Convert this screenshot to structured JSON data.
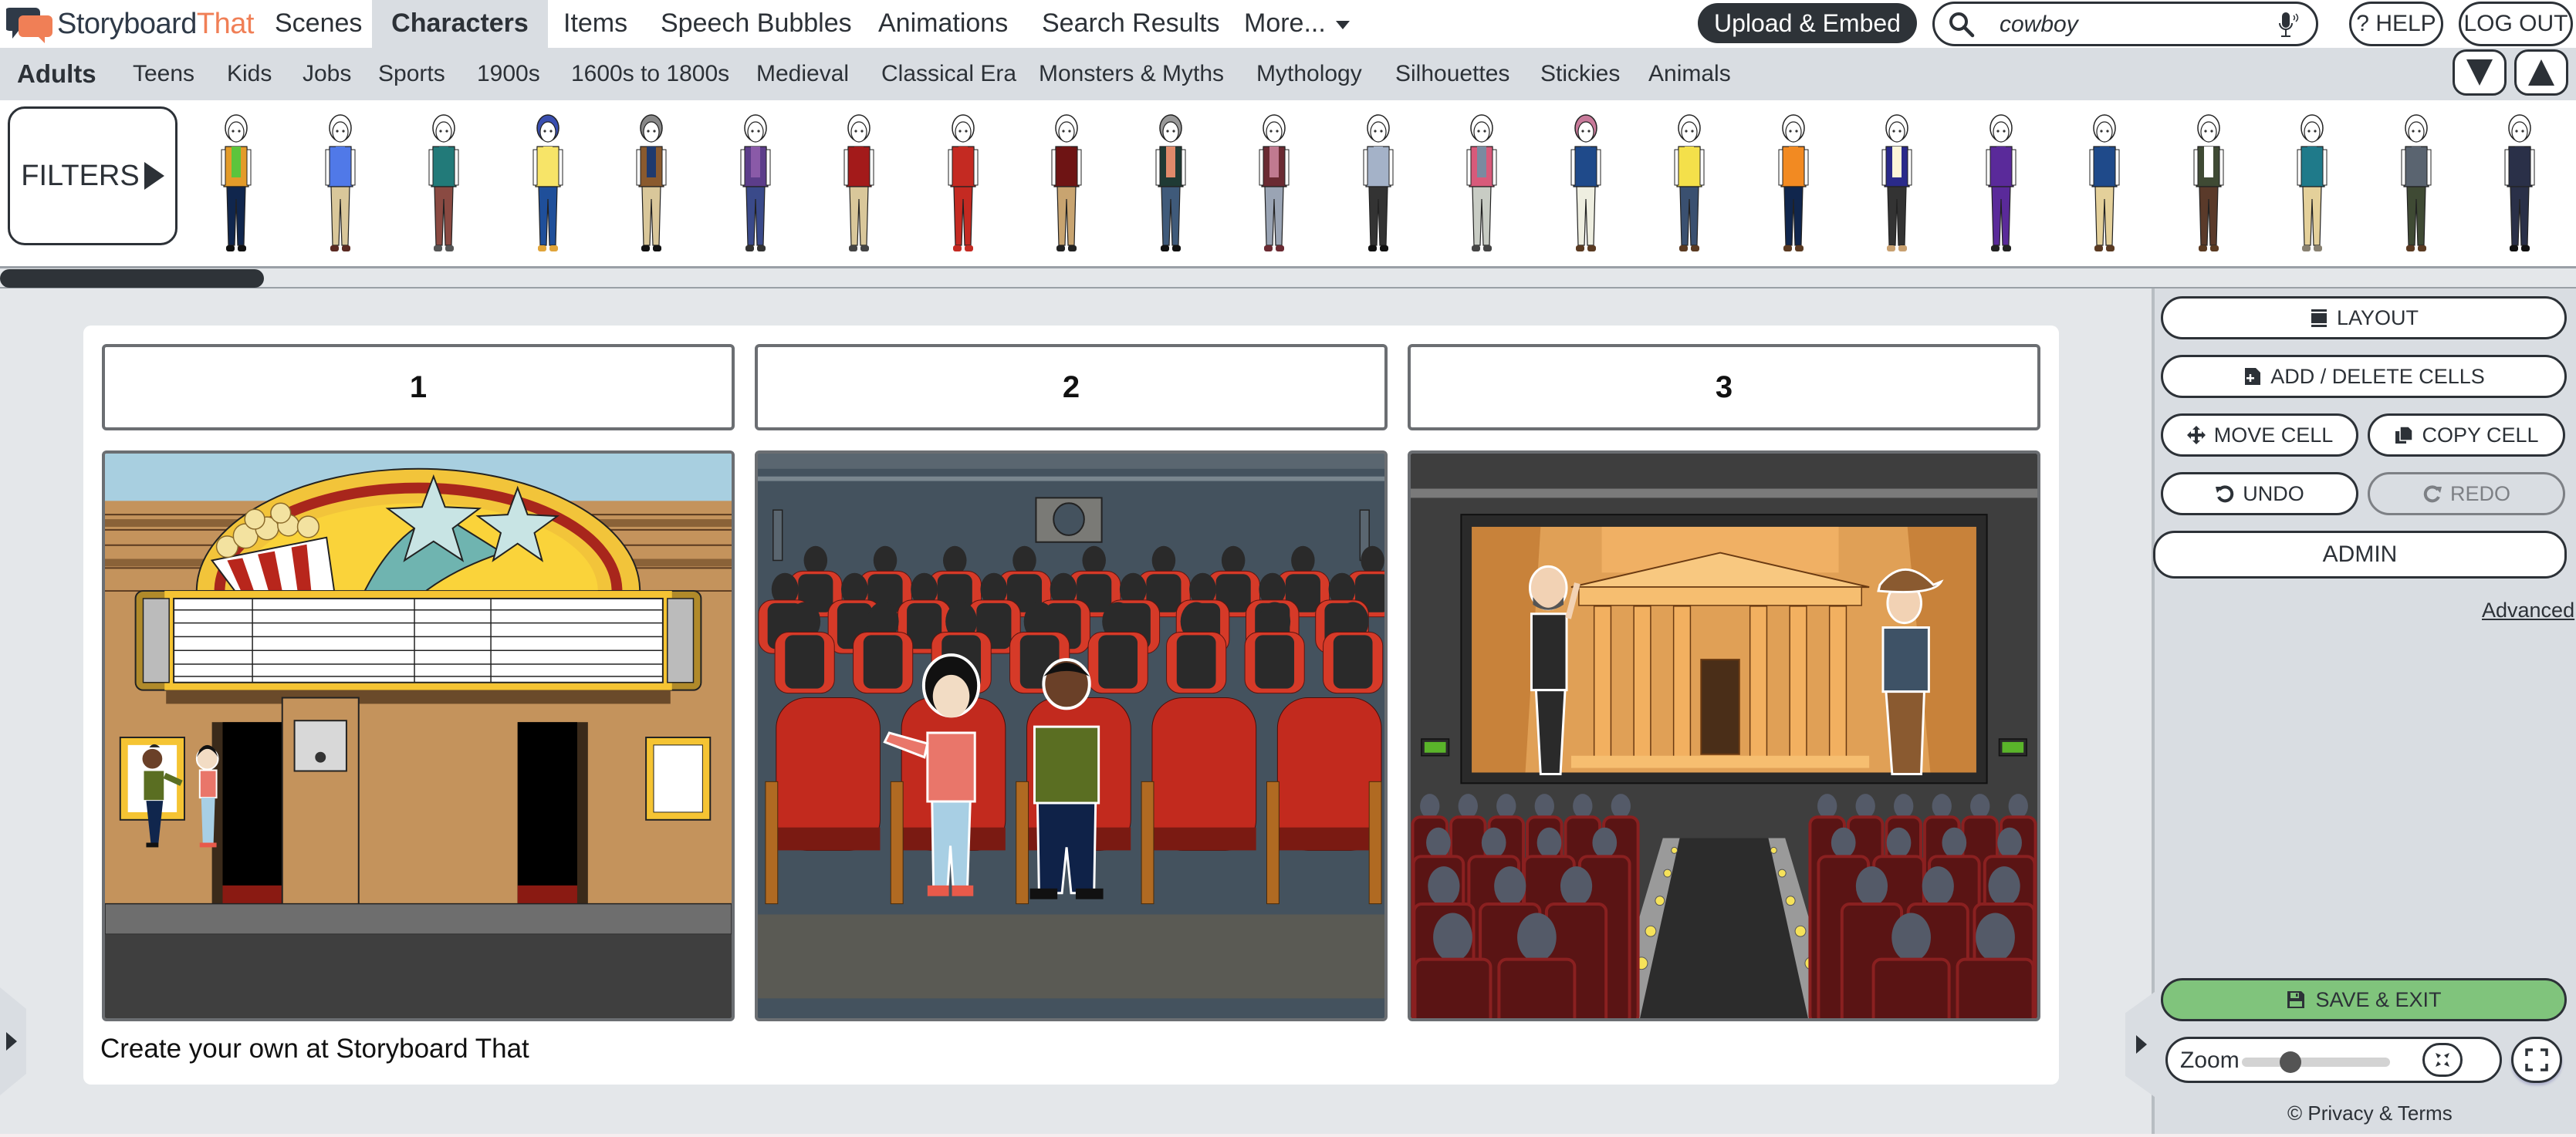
{
  "brand": {
    "name_part1": "Storyboard",
    "name_part2": "That",
    "colors": {
      "dark": "#2f3a48",
      "accent": "#f07f56"
    }
  },
  "top_nav": {
    "tabs": [
      {
        "label": "Scenes",
        "active": false
      },
      {
        "label": "Characters",
        "active": true
      },
      {
        "label": "Items",
        "active": false
      },
      {
        "label": "Speech Bubbles",
        "active": false
      },
      {
        "label": "Animations",
        "active": false
      },
      {
        "label": "Search Results",
        "active": false
      },
      {
        "label": "More...",
        "active": false,
        "icon": "caret-down-icon"
      }
    ],
    "upload_label": "Upload & Embed",
    "search": {
      "value": "cowboy",
      "icon": "search-icon",
      "mic_icon": "microphone-icon"
    },
    "help_label": "? HELP",
    "logout_label": "LOG OUT"
  },
  "sub_nav": {
    "items": [
      {
        "label": "Adults",
        "active": true
      },
      {
        "label": "Teens"
      },
      {
        "label": "Kids"
      },
      {
        "label": "Jobs"
      },
      {
        "label": "Sports"
      },
      {
        "label": "1900s"
      },
      {
        "label": "1600s to 1800s"
      },
      {
        "label": "Medieval"
      },
      {
        "label": "Classical Era"
      },
      {
        "label": "Monsters & Myths"
      },
      {
        "label": "Mythology"
      },
      {
        "label": "Silhouettes"
      },
      {
        "label": "Stickies"
      },
      {
        "label": "Animals"
      }
    ],
    "collapse_icon": "triangle-down-icon",
    "expand_icon": "triangle-up-icon"
  },
  "character_library": {
    "filters_label": "FILTERS",
    "characters": [
      {
        "top": "#e39b2a",
        "inner": "#5cc43c",
        "pants": "#10264d",
        "shoes": "#111111",
        "hair": "white"
      },
      {
        "top": "#5079e8",
        "inner": "#5079e8",
        "pants": "#d9c79a",
        "shoes": "#5a2a22",
        "hair": "white"
      },
      {
        "top": "#227a79",
        "inner": "#227a79",
        "pants": "#8a4a42",
        "shoes": "#555555",
        "hair": "white"
      },
      {
        "top": "#f7e468",
        "inner": "#f7e468",
        "pants": "#1f4f9a",
        "shoes": "#e0a43a",
        "hair": "#3a4fb0"
      },
      {
        "top": "#8a5a2e",
        "inner": "#1f3a6e",
        "pants": "#d9c79a",
        "shoes": "#111111",
        "hair": "#888888"
      },
      {
        "top": "#5c3d8a",
        "inner": "#8a5aa8",
        "pants": "#3a4a8a",
        "shoes": "#333333",
        "hair": "white"
      },
      {
        "top": "#a31a1a",
        "inner": "#a31a1a",
        "pants": "#d9c79a",
        "shoes": "#444444",
        "hair": "white"
      },
      {
        "top": "#c42a22",
        "inner": "#c42a22",
        "pants": "#c42a22",
        "shoes": "#c42a22",
        "hair": "white"
      },
      {
        "top": "#6e1414",
        "inner": "#6e1414",
        "pants": "#c8a470",
        "shoes": "#222222",
        "hair": "white"
      },
      {
        "top": "#1f3a34",
        "inner": "#e08a6a",
        "pants": "#3f5a7a",
        "shoes": "#111111",
        "hair": "#999999"
      },
      {
        "top": "#6a2a32",
        "inner": "#c07a90",
        "pants": "#9aa4b4",
        "shoes": "#6a2a32",
        "hair": "white"
      },
      {
        "top": "#a4b2c8",
        "inner": "#a4b2c8",
        "pants": "#333333",
        "shoes": "#111111",
        "hair": "white"
      },
      {
        "top": "#d85a7a",
        "inner": "#7a8aa0",
        "pants": "#c8ccc4",
        "shoes": "#444444",
        "hair": "white"
      },
      {
        "top": "#1f4a8a",
        "inner": "#1f4a8a",
        "pants": "#eeeee0",
        "shoes": "#5a3a22",
        "hair": "#c87a9a"
      },
      {
        "top": "#f4e04a",
        "inner": "#f4e04a",
        "pants": "#3a5070",
        "shoes": "#5a3a22",
        "hair": "white"
      },
      {
        "top": "#f28a22",
        "inner": "#f28a22",
        "pants": "#10264d",
        "shoes": "#5a3a22",
        "hair": "white"
      },
      {
        "top": "#2a2a8a",
        "inner": "#fdf6d8",
        "pants": "#333333",
        "shoes": "#c8a070",
        "hair": "white"
      },
      {
        "top": "#5a2a9a",
        "inner": "#5a2a9a",
        "pants": "#5a2a9a",
        "shoes": "#222222",
        "hair": "white"
      },
      {
        "top": "#1f4a8a",
        "inner": "#1f4a8a",
        "pants": "#e4d09a",
        "shoes": "#5a3a22",
        "hair": "white"
      },
      {
        "top": "#3f4a34",
        "inner": "#ffffff",
        "pants": "#5a3a2a",
        "shoes": "#5a3a22",
        "hair": "white"
      },
      {
        "top": "#1f7a8a",
        "inner": "#1f7a8a",
        "pants": "#e4d09a",
        "shoes": "#888070",
        "hair": "white"
      },
      {
        "top": "#5a6470",
        "inner": "#5a6470",
        "pants": "#3f4a34",
        "shoes": "#5a3a22",
        "hair": "white"
      },
      {
        "top": "#2a3048",
        "inner": "#2a3048",
        "pants": "#2a3048",
        "shoes": "#111111",
        "hair": "white"
      }
    ]
  },
  "storyboard": {
    "cells": [
      {
        "title": "1",
        "scene": "movie theater exterior marquee with popcorn and stars; two teens talking on sidewalk"
      },
      {
        "title": "2",
        "scene": "theater auditorium with red seats and silhouetted audience; two teens seated in front"
      },
      {
        "title": "3",
        "scene": "theater screen showing a professor and a cowboy at an ancient temple; audience in red seats"
      }
    ],
    "footer_note": "Create your own at Storyboard That"
  },
  "side_panel": {
    "layout_label": "LAYOUT",
    "add_delete_label": "ADD / DELETE CELLS",
    "move_cell_label": "MOVE CELL",
    "copy_cell_label": "COPY CELL",
    "undo_label": "UNDO",
    "redo_label": "REDO",
    "redo_disabled": true,
    "admin_label": "ADMIN",
    "advanced_label": "Advanced",
    "save_exit_label": "SAVE & EXIT",
    "save_color": "#80c47c",
    "zoom_label": "Zoom",
    "zoom_level": 0.33,
    "privacy_label": "© Privacy & Terms"
  },
  "scrollbar": {
    "horizontal_position": 0.0
  }
}
